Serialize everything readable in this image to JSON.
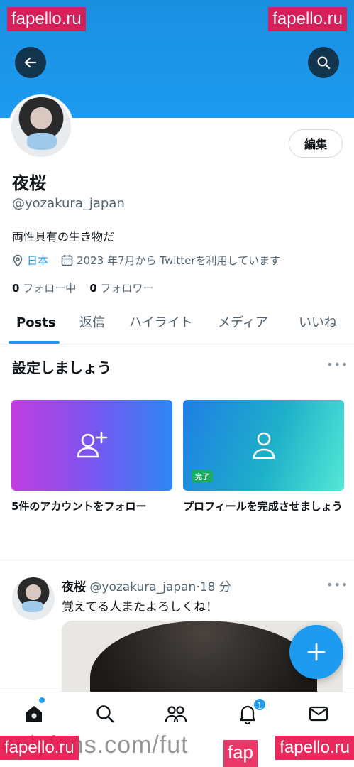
{
  "watermarks": {
    "top_left": "fapello.ru",
    "top_right": "fapello.ru",
    "bottom_left": "fapello.ru",
    "bottom_right": "fapello.ru",
    "bottom_mid": "fap"
  },
  "footer_url": "onlyfans.com/fut",
  "profile": {
    "display_name": "夜桜",
    "handle": "@yozakura_japan",
    "bio": "両性具有の生き物だ",
    "location": "日本",
    "joined": "2023 年7月から Twitterを利用しています",
    "following_count": "0",
    "following_label": "フォロー中",
    "followers_count": "0",
    "followers_label": "フォロワー",
    "edit_label": "編集"
  },
  "tabs": [
    {
      "label": "Posts",
      "active": true
    },
    {
      "label": "返信"
    },
    {
      "label": "ハイライト"
    },
    {
      "label": "メディア"
    },
    {
      "label": "いいね"
    }
  ],
  "setup": {
    "title": "設定しましょう",
    "more": "•••",
    "cards": [
      {
        "label": "5件のアカウントをフォロー",
        "icon": "add-user-icon"
      },
      {
        "label": "プロフィールを完成させましょう",
        "badge": "完了",
        "icon": "user-icon"
      }
    ]
  },
  "post": {
    "name": "夜桜",
    "handle": "@yozakura_japan",
    "time": "18 分",
    "text": "覚えてる人またよろしくね！",
    "more": "•••"
  },
  "nav": {
    "notifications_badge": "1"
  },
  "colors": {
    "accent": "#1d9bf0",
    "banner": "#1d9bf0",
    "watermark": "#e8164e"
  }
}
